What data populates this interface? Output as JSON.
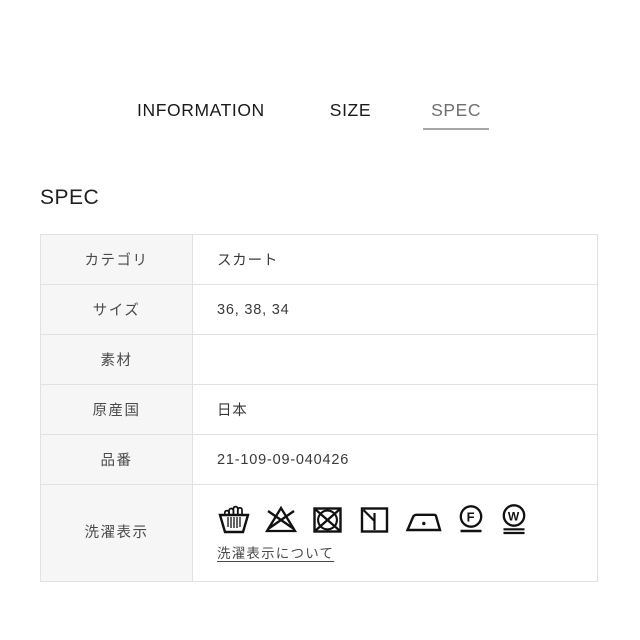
{
  "tabs": [
    {
      "label": "INFORMATION",
      "active": false
    },
    {
      "label": "SIZE",
      "active": false
    },
    {
      "label": "SPEC",
      "active": true
    }
  ],
  "section": {
    "title": "SPEC"
  },
  "spec_table": {
    "rows": [
      {
        "label": "カテゴリ",
        "value": "スカート"
      },
      {
        "label": "サイズ",
        "value": "36, 38, 34"
      },
      {
        "label": "素材",
        "value": ""
      },
      {
        "label": "原産国",
        "value": "日本"
      },
      {
        "label": "品番",
        "value": "21-109-09-040426"
      }
    ],
    "care_row": {
      "label": "洗濯表示",
      "link_label": "洗濯表示について",
      "symbols": [
        {
          "name": "hand-wash-icon",
          "title": "手洗い"
        },
        {
          "name": "do-not-bleach-icon",
          "title": "漂白禁止"
        },
        {
          "name": "do-not-tumble-dry-icon",
          "title": "タンブル乾燥禁止"
        },
        {
          "name": "drip-dry-in-shade-icon",
          "title": "陰干し"
        },
        {
          "name": "iron-low-heat-icon",
          "title": "低温アイロン"
        },
        {
          "name": "dryclean-petroleum-icon",
          "title": "石油系ドライクリーニング",
          "letter": "F"
        },
        {
          "name": "wet-clean-very-mild-icon",
          "title": "ウェットクリーニング",
          "letter": "W"
        }
      ]
    }
  },
  "colors": {
    "background": "#ffffff",
    "text": "#222222",
    "muted_text": "#6f6f6f",
    "header_cell_bg": "#f6f6f6",
    "border": "#e2e2e2",
    "active_tab_underline": "#a6a6a6"
  }
}
